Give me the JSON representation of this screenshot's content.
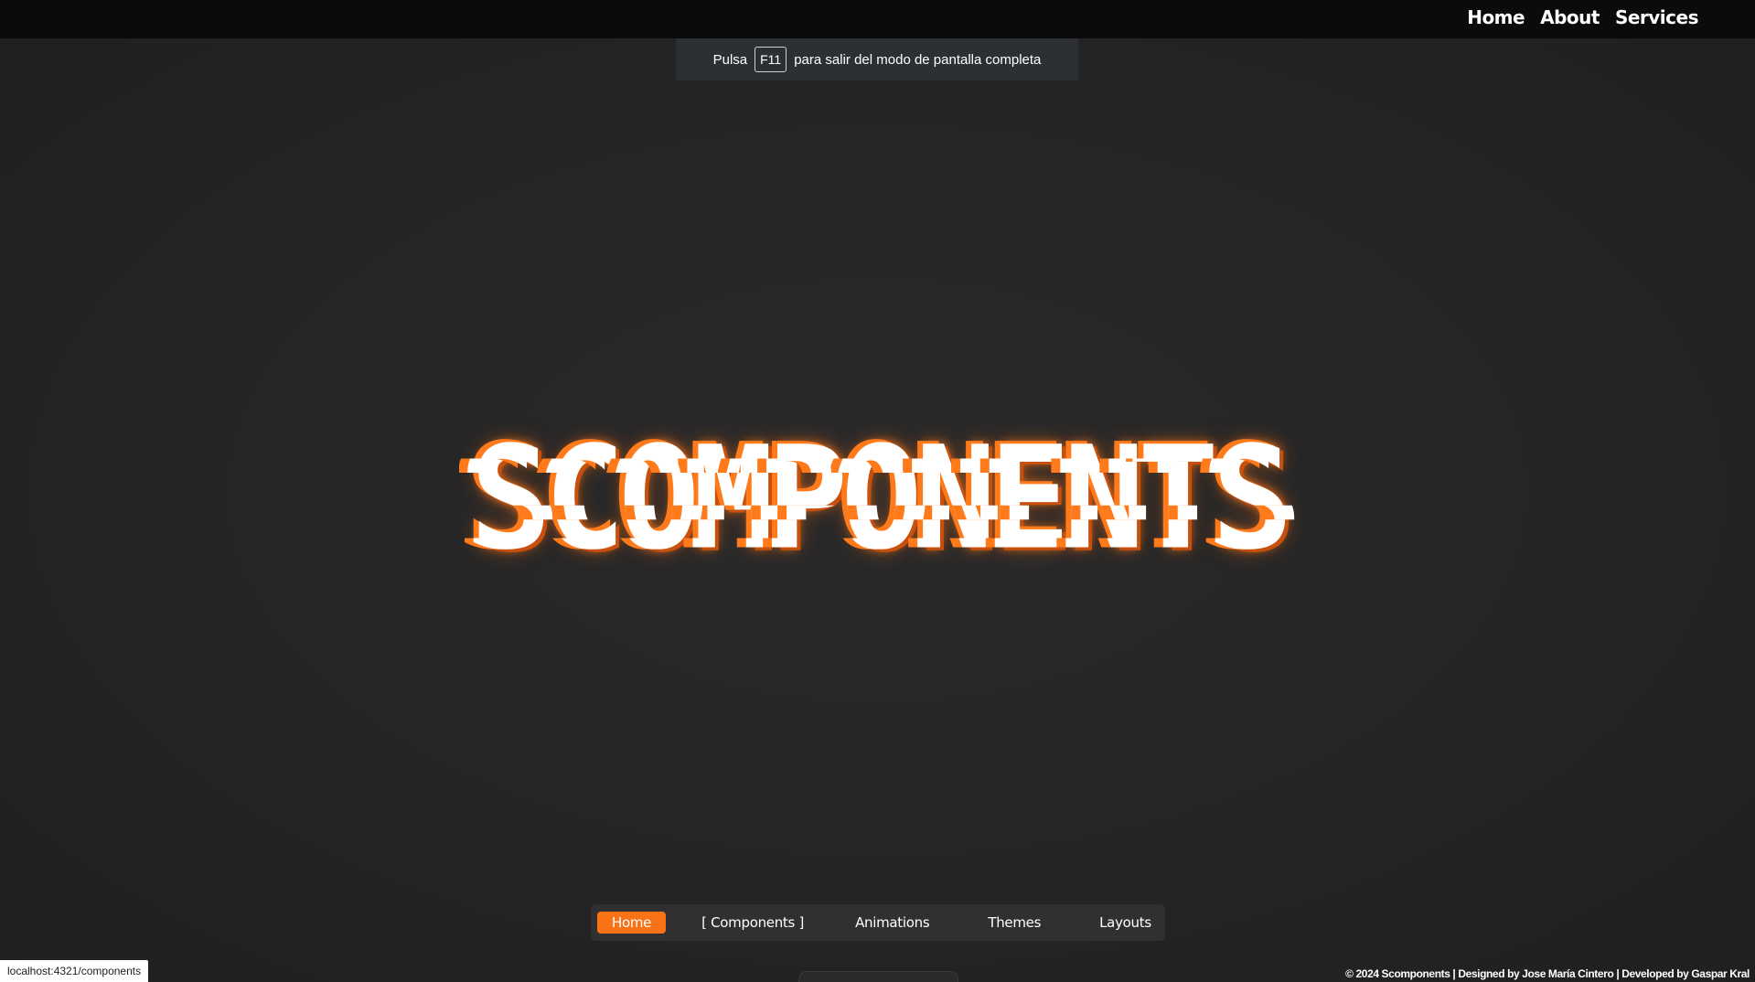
{
  "topnav": {
    "items": [
      {
        "label": "Home"
      },
      {
        "label": "About"
      },
      {
        "label": "Services"
      }
    ]
  },
  "fullscreen_notice": {
    "prefix": "Pulsa",
    "key": "F11",
    "suffix": "para salir del modo de pantalla completa"
  },
  "hero": {
    "title": "SCOMPONENTS"
  },
  "bottom_nav": {
    "items": [
      {
        "label": "Home",
        "active": true
      },
      {
        "label": "[ Components ]"
      },
      {
        "label": "Animations"
      },
      {
        "label": "Themes"
      },
      {
        "label": "Layouts"
      }
    ]
  },
  "status_bar": {
    "url": "localhost:4321/components"
  },
  "footer": {
    "text": "© 2024 Scomponents | Designed by Jose María Cintero | Developed by Gaspar Kral"
  },
  "colors": {
    "accent": "#f97316",
    "background": "#262626",
    "topbar": "#0b0b0b"
  }
}
